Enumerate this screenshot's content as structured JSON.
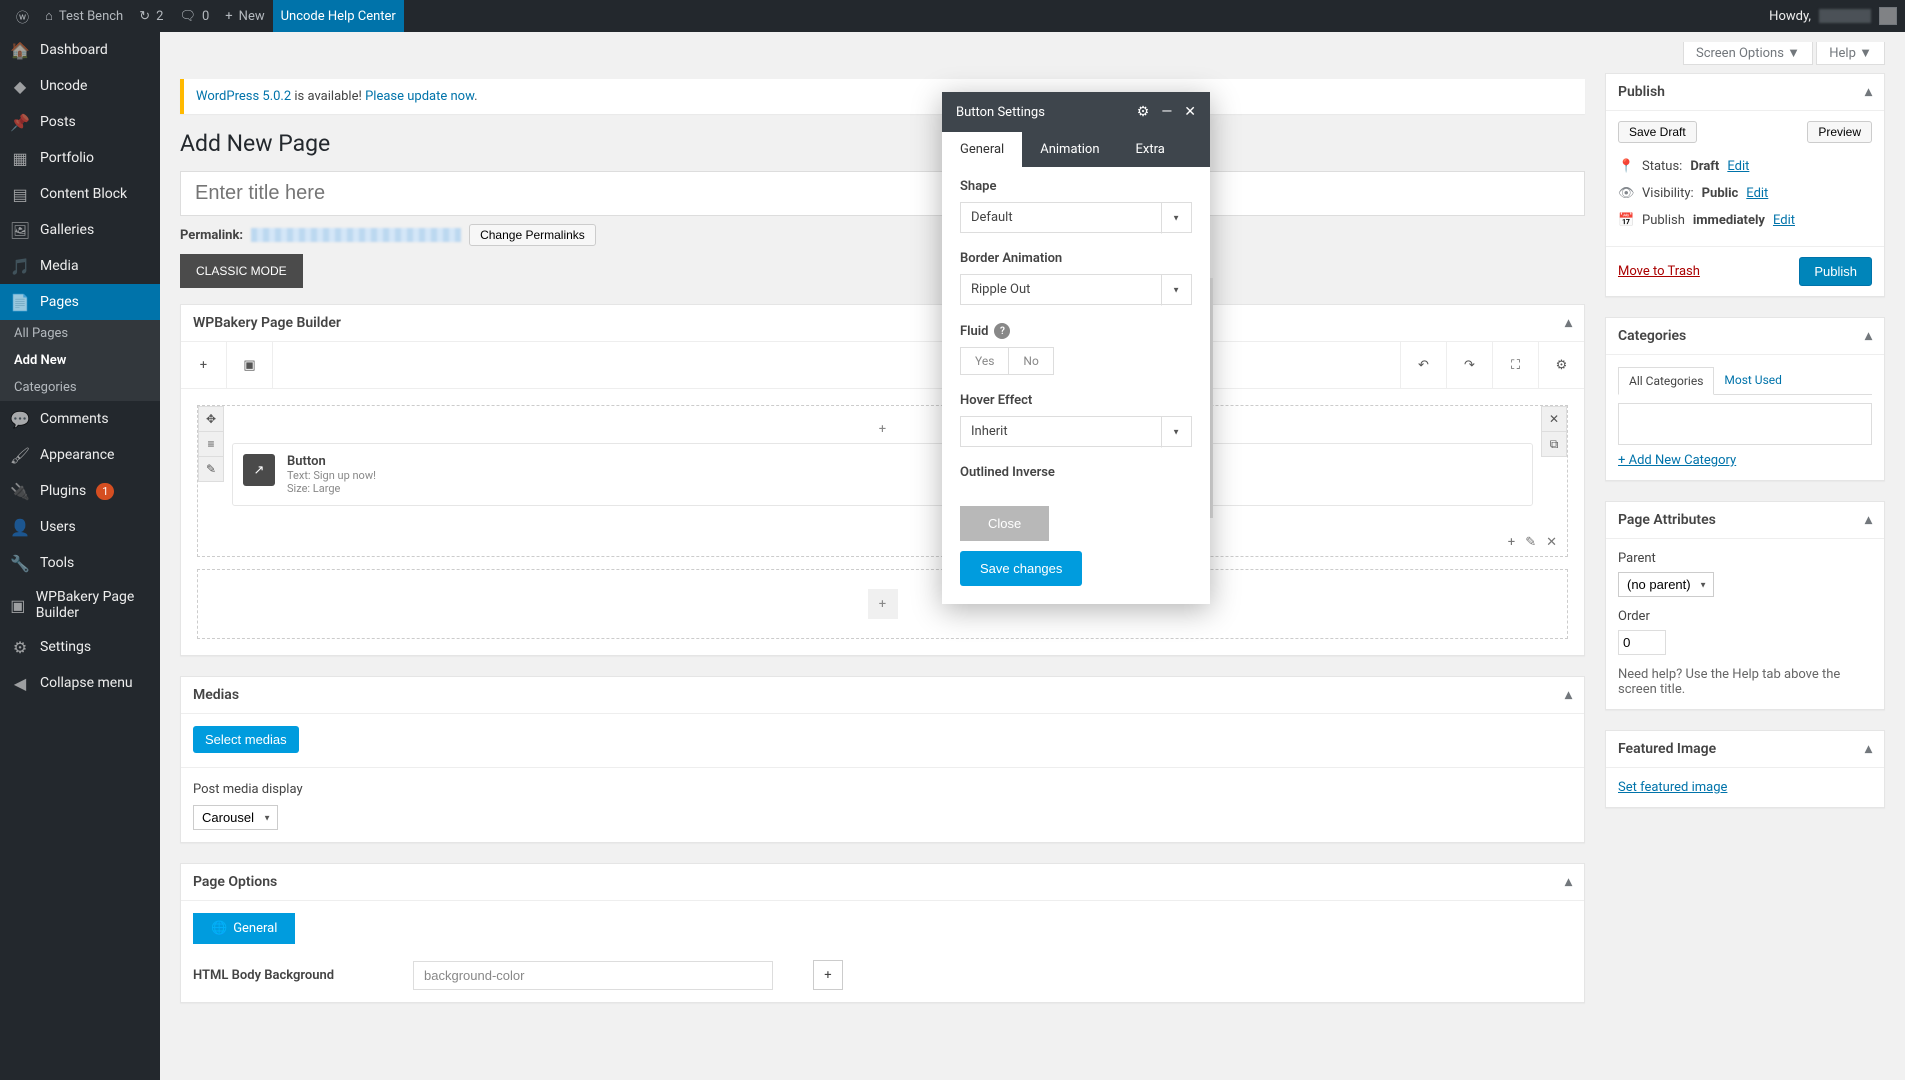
{
  "adminbar": {
    "site": "Test Bench",
    "refresh": "2",
    "comments": "0",
    "new": "New",
    "help_center": "Uncode Help Center",
    "howdy": "Howdy,"
  },
  "sidebar": {
    "items": [
      {
        "label": "Dashboard"
      },
      {
        "label": "Uncode"
      },
      {
        "label": "Posts"
      },
      {
        "label": "Portfolio"
      },
      {
        "label": "Content Block"
      },
      {
        "label": "Galleries"
      },
      {
        "label": "Media"
      },
      {
        "label": "Pages"
      },
      {
        "label": "Comments"
      },
      {
        "label": "Appearance"
      },
      {
        "label": "Plugins",
        "badge": "1"
      },
      {
        "label": "Users"
      },
      {
        "label": "Tools"
      },
      {
        "label": "WPBakery Page Builder"
      },
      {
        "label": "Settings"
      },
      {
        "label": "Collapse menu"
      }
    ],
    "sub": {
      "all": "All Pages",
      "add": "Add New",
      "cat": "Categories"
    }
  },
  "screen_meta": {
    "options": "Screen Options",
    "help": "Help"
  },
  "notice": {
    "pre": "WordPress 5.0.2",
    "mid": " is available! ",
    "link": "Please update now"
  },
  "page": {
    "title": "Add New Page",
    "title_placeholder": "Enter title here",
    "permalink_label": "Permalink:",
    "change_permalinks": "Change Permalinks",
    "classic_mode": "CLASSIC MODE"
  },
  "builder": {
    "title": "WPBakery Page Builder",
    "element": {
      "name": "Button",
      "meta1": "Text: Sign up now!",
      "meta2": "Size: Large"
    }
  },
  "medias": {
    "title": "Medias",
    "select": "Select medias",
    "post_media_display": "Post media display",
    "display_value": "Carousel"
  },
  "page_options": {
    "title": "Page Options",
    "general_tab": "General",
    "field_label": "HTML Body Background",
    "field_value": "background-color"
  },
  "publish": {
    "title": "Publish",
    "save_draft": "Save Draft",
    "preview": "Preview",
    "status_label": "Status:",
    "status_val": "Draft",
    "edit": "Edit",
    "vis_label": "Visibility:",
    "vis_val": "Public",
    "pub_label": "Publish",
    "pub_val": "immediately",
    "trash": "Move to Trash",
    "publish_btn": "Publish"
  },
  "categories": {
    "title": "Categories",
    "tab_all": "All Categories",
    "tab_most": "Most Used",
    "add_new": "+ Add New Category"
  },
  "attrs": {
    "title": "Page Attributes",
    "parent": "Parent",
    "parent_val": "(no parent)",
    "order": "Order",
    "order_val": "0",
    "help": "Need help? Use the Help tab above the screen title."
  },
  "featured": {
    "title": "Featured Image",
    "set": "Set featured image"
  },
  "modal": {
    "title": "Button Settings",
    "tabs": {
      "general": "General",
      "animation": "Animation",
      "extra": "Extra"
    },
    "shape": {
      "label": "Shape",
      "value": "Default"
    },
    "border_anim": {
      "label": "Border Animation",
      "value": "Ripple Out"
    },
    "fluid": {
      "label": "Fluid",
      "yes": "Yes",
      "no": "No"
    },
    "hover": {
      "label": "Hover Effect",
      "value": "Inherit"
    },
    "outlined_inverse": {
      "label": "Outlined Inverse"
    },
    "close": "Close",
    "save": "Save changes"
  }
}
